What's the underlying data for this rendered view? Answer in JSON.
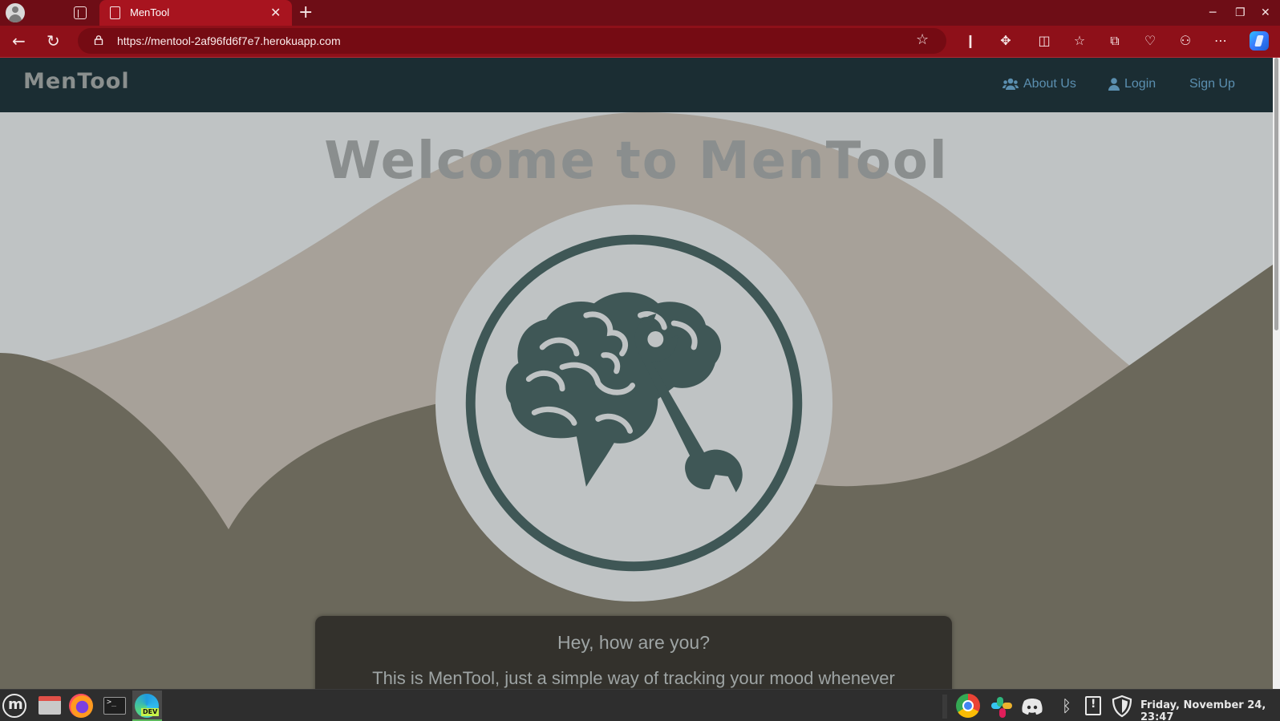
{
  "browser": {
    "tab_title": "MenTool",
    "url": "https://mentool-2af96fd6f7e7.herokuapp.com",
    "theme_color": "#8e1019"
  },
  "site": {
    "brand": "MenTool",
    "nav": {
      "about": "About Us",
      "login": "Login",
      "signup": "Sign Up"
    },
    "hero_title": "Welcome to MenTool",
    "card": {
      "greeting": "Hey, how are you?",
      "intro": "This is MenTool, just a simple way of tracking your mood whenever"
    },
    "colors": {
      "navbar": "#1b2d33",
      "accent_link": "#5b8fb0",
      "logo_ink": "#3f5756"
    }
  },
  "taskbar": {
    "clock": "Friday, November 24, 23:47",
    "edge_badge": "DEV",
    "term_prompt": ">_"
  },
  "icons": [
    "profile-icon",
    "tab-actions-icon",
    "page-icon",
    "close-icon",
    "plus-icon",
    "back-icon",
    "refresh-icon",
    "lock-icon",
    "star-icon",
    "extensions-icon",
    "split-screen-icon",
    "favorites-icon",
    "collections-icon",
    "more-icon",
    "copilot-icon",
    "users-icon",
    "user-icon",
    "brain-wrench-icon",
    "mint-menu-icon",
    "files-icon",
    "firefox-icon",
    "terminal-icon",
    "edge-dev-icon",
    "chrome-icon",
    "slack-icon",
    "discord-icon",
    "bluetooth-icon",
    "update-icon",
    "shield-icon"
  ]
}
